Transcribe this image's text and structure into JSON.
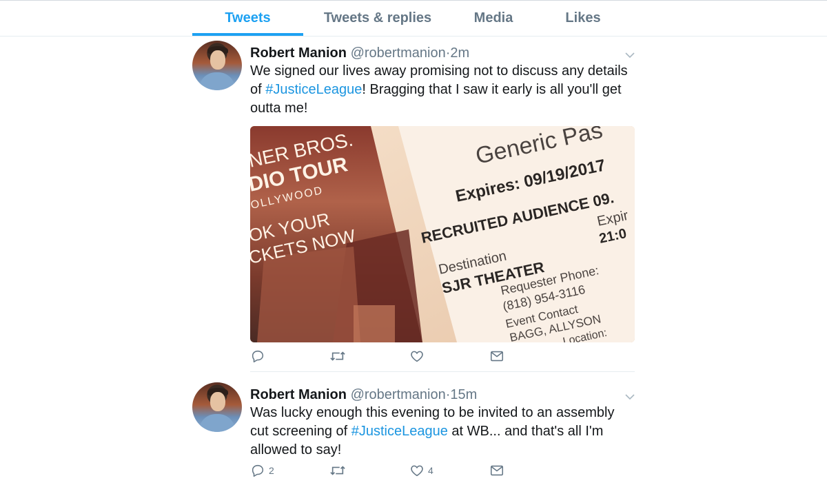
{
  "tabs": [
    {
      "label": "Tweets",
      "active": true
    },
    {
      "label": "Tweets & replies",
      "active": false
    },
    {
      "label": "Media",
      "active": false
    },
    {
      "label": "Likes",
      "active": false
    }
  ],
  "tweets": [
    {
      "author": "Robert Manion",
      "handle": "@robertmanion",
      "separator": "·",
      "time": "2m",
      "text_before": "We signed our lives away promising not to discuss any details of ",
      "hashtag": "#JusticeLeague",
      "text_after": "! Bragging that I saw it early is all you'll get outta me!",
      "media": {
        "left_card": [
          "NER BROS.",
          "DIO TOUR",
          "OLLYWOOD",
          "OK YOUR",
          "CKETS NOW"
        ],
        "pass_title": "Generic Pas",
        "expires": "Expires: 09/19/2017",
        "recruited": "RECRUITED AUDIENCE 09.",
        "expir_label": "Expir",
        "expir_time": "21:0",
        "destination_label": "Destination",
        "destination": "SJR THEATER",
        "requester_label": "Requester Phone:",
        "requester_phone": "(818) 954-3116",
        "contact_label": "Event Contact",
        "contact_name": "BAGG, ALLYSON",
        "location_label": "Location:"
      },
      "reply_count": "",
      "retweet_count": "",
      "like_count": ""
    },
    {
      "author": "Robert Manion",
      "handle": "@robertmanion",
      "separator": "·",
      "time": "15m",
      "text_before": "Was lucky enough this evening to be invited to an assembly cut screening of ",
      "hashtag": "#JusticeLeague",
      "text_after": " at WB... and that's all I'm allowed to say!",
      "reply_count": "2",
      "retweet_count": "",
      "like_count": "4"
    }
  ],
  "icons": {
    "reply": "reply-icon",
    "retweet": "retweet-icon",
    "like": "heart-icon",
    "message": "envelope-icon",
    "caret": "chevron-down-icon"
  },
  "colors": {
    "accent": "#1da1f2",
    "link": "#1b95e0",
    "muted": "#657786",
    "text": "#14171a",
    "border": "#e6ecf0"
  }
}
